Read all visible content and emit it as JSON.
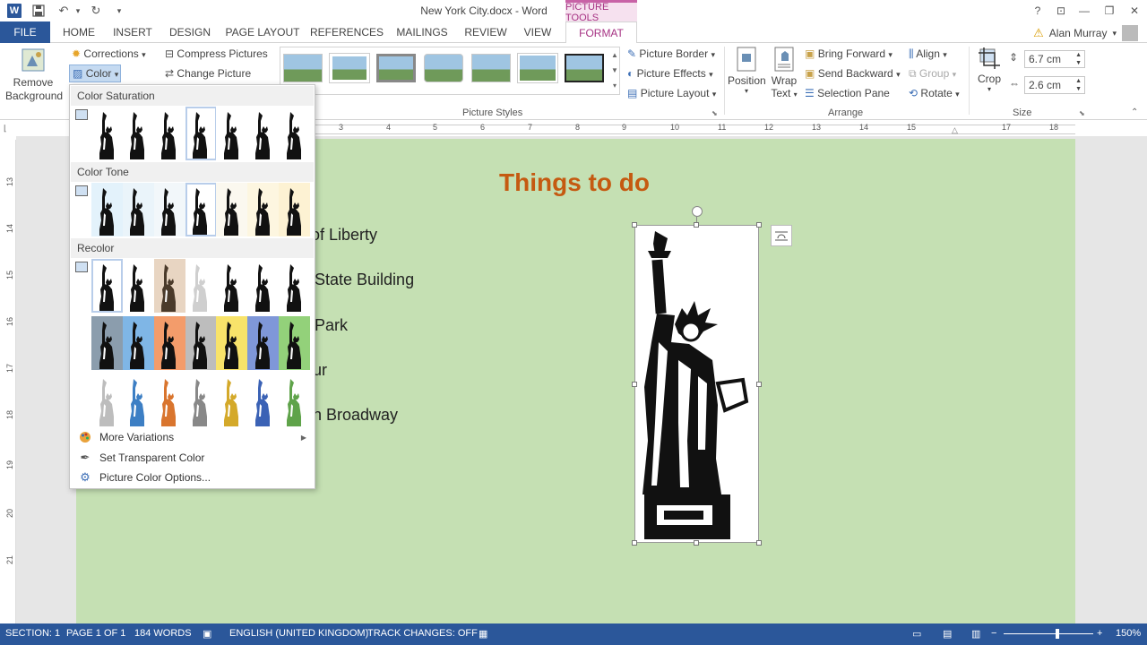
{
  "window": {
    "title": "New York City.docx - Word",
    "contextual_tab_group": "PICTURE TOOLS",
    "user_name": "Alan Murray"
  },
  "tabs": [
    {
      "label": "FILE"
    },
    {
      "label": "HOME"
    },
    {
      "label": "INSERT"
    },
    {
      "label": "DESIGN"
    },
    {
      "label": "PAGE LAYOUT"
    },
    {
      "label": "REFERENCES"
    },
    {
      "label": "MAILINGS"
    },
    {
      "label": "REVIEW"
    },
    {
      "label": "VIEW"
    },
    {
      "label": "FORMAT"
    }
  ],
  "ribbon": {
    "remove_background": "Remove\nBackground",
    "corrections": "Corrections",
    "color": "Color",
    "compress_pictures": "Compress Pictures",
    "change_picture": "Change Picture",
    "picture_styles_label": "Picture Styles",
    "picture_border": "Picture Border",
    "picture_effects": "Picture Effects",
    "picture_layout": "Picture Layout",
    "position": "Position",
    "wrap_text_1": "Wrap",
    "wrap_text_2": "Text",
    "bring_forward": "Bring Forward",
    "send_backward": "Send Backward",
    "selection_pane": "Selection Pane",
    "align": "Align",
    "group": "Group",
    "rotate": "Rotate",
    "arrange_label": "Arrange",
    "crop": "Crop",
    "height": "6.7 cm",
    "width": "2.6 cm",
    "size_label": "Size"
  },
  "ruler": {
    "h_numbers": [
      "3",
      "4",
      "5",
      "6",
      "7",
      "8",
      "9",
      "10",
      "11",
      "12",
      "13",
      "14",
      "15",
      "17",
      "18"
    ],
    "v_numbers": [
      "13",
      "14",
      "15",
      "16",
      "17",
      "18",
      "19",
      "20",
      "21"
    ]
  },
  "document": {
    "heading": "Things to do",
    "lines": [
      "of Liberty",
      "State Building",
      "Park",
      "ur",
      "n Broadway"
    ]
  },
  "gallery": {
    "color_saturation": "Color Saturation",
    "color_tone": "Color Tone",
    "recolor": "Recolor",
    "more_variations": "More Variations",
    "set_transparent": "Set Transparent Color",
    "color_options": "Picture Color Options...",
    "saturation_tints": [
      "#ffffff",
      "#ffffff",
      "#ffffff",
      "#ffffff",
      "#ffffff",
      "#ffffff",
      "#ffffff"
    ],
    "tone_tints": [
      "#e3f2fb",
      "#eaf4fa",
      "#f2f7fa",
      "#ffffff",
      "#fbf8ef",
      "#fdf6e0",
      "#fdf2d3"
    ],
    "recolor_row1": [
      "#ffffff",
      "#ffffff",
      "#e8d5c2",
      "#ffffff",
      "#ffffff",
      "#ffffff",
      "#ffffff"
    ],
    "recolor_row2": [
      "#8b9dad",
      "#7fb6e6",
      "#f39c6b",
      "#bdbdbd",
      "#f8e36a",
      "#7f97d8",
      "#93d17a"
    ],
    "recolor_row3": [
      "#ffffff",
      "#ffffff",
      "#ffffff",
      "#ffffff",
      "#ffffff",
      "#ffffff",
      "#ffffff"
    ],
    "figure_row1": [
      "#111111",
      "#111111",
      "#4a3a2a",
      "#cfcfcf",
      "#111111",
      "#111111",
      "#111111"
    ],
    "figure_row2": [
      "#111111",
      "#111111",
      "#111111",
      "#111111",
      "#111111",
      "#111111",
      "#111111"
    ],
    "figure_row3": [
      "#bdbdbd",
      "#3d7fc4",
      "#d9752e",
      "#888888",
      "#d4a92a",
      "#3b62b5",
      "#5fa34a"
    ]
  },
  "status": {
    "section": "SECTION: 1",
    "page": "PAGE 1 OF 1",
    "words": "184 WORDS",
    "language": "ENGLISH (UNITED KINGDOM)",
    "track_changes": "TRACK CHANGES: OFF",
    "zoom": "150%"
  },
  "colors": {
    "word_blue": "#2b579a",
    "format_tab": "#a63283",
    "page_bg": "#c5e0b3",
    "heading": "#c55a11"
  }
}
